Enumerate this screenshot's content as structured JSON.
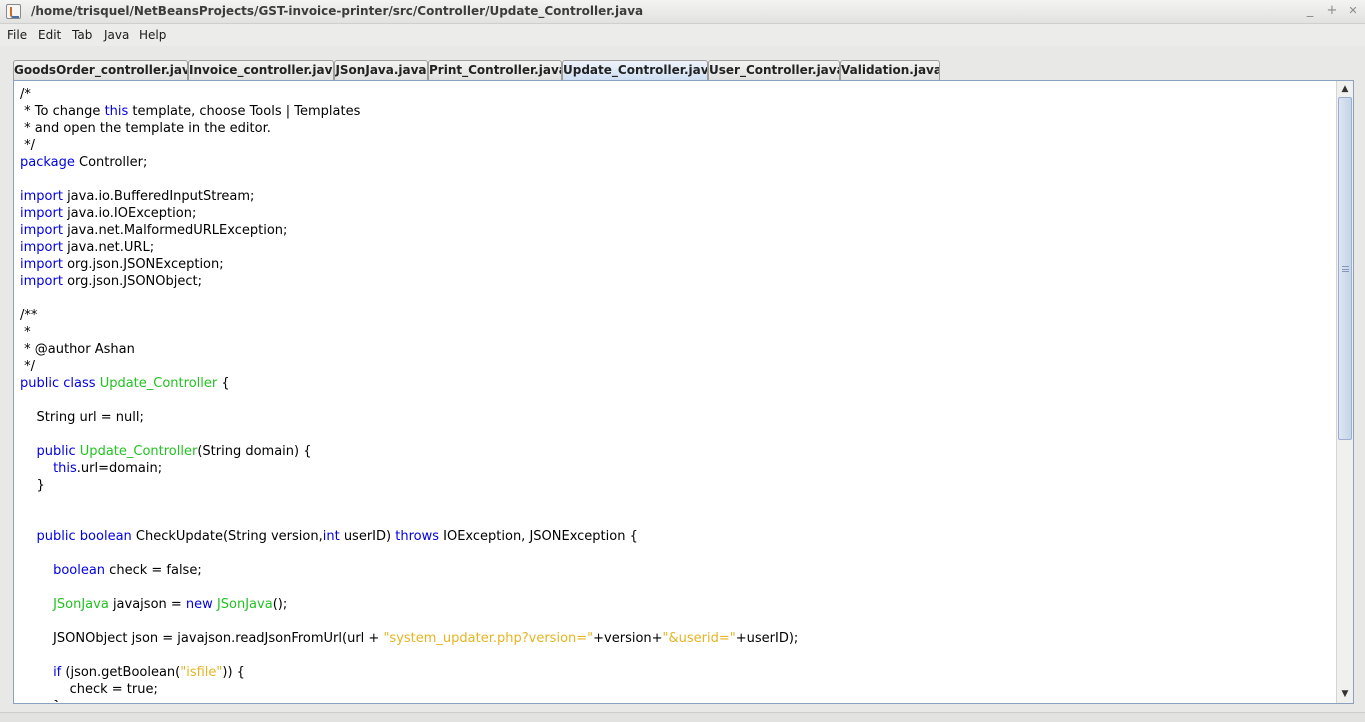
{
  "window": {
    "title": "/home/trisquel/NetBeansProjects/GST-invoice-printer/src/Controller/Update_Controller.java",
    "controls": {
      "minimize": "_",
      "maximize": "+",
      "close": "✕"
    }
  },
  "menu": [
    "File",
    "Edit",
    "Tab",
    "Java",
    "Help"
  ],
  "tabs": [
    {
      "label": "GoodsOrder_controller.java"
    },
    {
      "label": "Invoice_controller.java"
    },
    {
      "label": "JSonJava.java"
    },
    {
      "label": "Print_Controller.java"
    },
    {
      "label": "Update_Controller.java",
      "active": true
    },
    {
      "label": "User_Controller.java"
    },
    {
      "label": "Validation.java"
    }
  ],
  "syntax_colors": {
    "keyword": "#0000e6",
    "class_name": "#22c222",
    "string": "#e6b422"
  },
  "code_lines": [
    [
      [
        "t",
        "/*"
      ]
    ],
    [
      [
        "t",
        " * To change "
      ],
      [
        "k",
        "this"
      ],
      [
        "t",
        " template, choose Tools | Templates"
      ]
    ],
    [
      [
        "t",
        " * and open the template in the editor."
      ]
    ],
    [
      [
        "t",
        " */"
      ]
    ],
    [
      [
        "k",
        "package"
      ],
      [
        "t",
        " Controller;"
      ]
    ],
    [],
    [
      [
        "k",
        "import"
      ],
      [
        "t",
        " java.io.BufferedInputStream;"
      ]
    ],
    [
      [
        "k",
        "import"
      ],
      [
        "t",
        " java.io.IOException;"
      ]
    ],
    [
      [
        "k",
        "import"
      ],
      [
        "t",
        " java.net.MalformedURLException;"
      ]
    ],
    [
      [
        "k",
        "import"
      ],
      [
        "t",
        " java.net.URL;"
      ]
    ],
    [
      [
        "k",
        "import"
      ],
      [
        "t",
        " org.json.JSONException;"
      ]
    ],
    [
      [
        "k",
        "import"
      ],
      [
        "t",
        " org.json.JSONObject;"
      ]
    ],
    [],
    [
      [
        "t",
        "/**"
      ]
    ],
    [
      [
        "t",
        " *"
      ]
    ],
    [
      [
        "t",
        " * @author Ashan"
      ]
    ],
    [
      [
        "t",
        " */"
      ]
    ],
    [
      [
        "k",
        "public"
      ],
      [
        "t",
        " "
      ],
      [
        "k",
        "class"
      ],
      [
        "t",
        " "
      ],
      [
        "c",
        "Update_Controller"
      ],
      [
        "t",
        " {"
      ]
    ],
    [],
    [
      [
        "t",
        "    String url = null;"
      ]
    ],
    [],
    [
      [
        "t",
        "    "
      ],
      [
        "k",
        "public"
      ],
      [
        "t",
        " "
      ],
      [
        "c",
        "Update_Controller"
      ],
      [
        "t",
        "(String domain) {"
      ]
    ],
    [
      [
        "t",
        "        "
      ],
      [
        "k",
        "this"
      ],
      [
        "t",
        ".url=domain;"
      ]
    ],
    [
      [
        "t",
        "    }"
      ]
    ],
    [],
    [],
    [
      [
        "t",
        "    "
      ],
      [
        "k",
        "public"
      ],
      [
        "t",
        " "
      ],
      [
        "k",
        "boolean"
      ],
      [
        "t",
        " CheckUpdate(String version,"
      ],
      [
        "k",
        "int"
      ],
      [
        "t",
        " userID) "
      ],
      [
        "k",
        "throws"
      ],
      [
        "t",
        " IOException, JSONException {"
      ]
    ],
    [],
    [
      [
        "t",
        "        "
      ],
      [
        "k",
        "boolean"
      ],
      [
        "t",
        " check = false;"
      ]
    ],
    [],
    [
      [
        "t",
        "        "
      ],
      [
        "c",
        "JSonJava"
      ],
      [
        "t",
        " javajson = "
      ],
      [
        "k",
        "new"
      ],
      [
        "t",
        " "
      ],
      [
        "c",
        "JSonJava"
      ],
      [
        "t",
        "();"
      ]
    ],
    [],
    [
      [
        "t",
        "        JSONObject json = javajson.readJsonFromUrl(url + "
      ],
      [
        "s",
        "\"system_updater.php?version=\""
      ],
      [
        "t",
        "+version+"
      ],
      [
        "s",
        "\"&userid=\""
      ],
      [
        "t",
        "+userID);"
      ]
    ],
    [],
    [
      [
        "t",
        "        "
      ],
      [
        "k",
        "if"
      ],
      [
        "t",
        " (json.getBoolean("
      ],
      [
        "s",
        "\"isfile\""
      ],
      [
        "t",
        ")) {"
      ]
    ],
    [
      [
        "t",
        "            check = true;"
      ]
    ],
    [
      [
        "t",
        "        }"
      ]
    ]
  ],
  "scrollbar": {
    "up_icon": "arrow-up",
    "down_icon": "arrow-down",
    "up_glyph": "▲",
    "down_glyph": "▼",
    "position_fraction": 0.0,
    "visible_fraction": 0.57
  }
}
